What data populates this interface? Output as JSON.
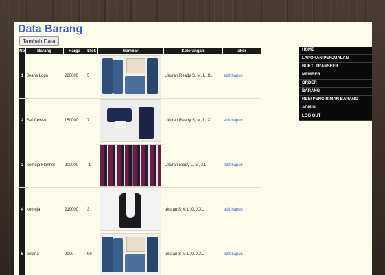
{
  "page": {
    "title": "Data Barang",
    "add_button": "Tambah Data"
  },
  "table": {
    "headers": [
      "No",
      "Barang",
      "Harga",
      "Stok",
      "Gambar",
      "Keterangan",
      "aksi"
    ],
    "rows": [
      {
        "no": "1",
        "name": "Jeans Logo",
        "price": "220000",
        "stock": "5",
        "note": "Ukuran Ready S, M, L, XL",
        "edit": "edit",
        "delete": "hapus"
      },
      {
        "no": "2",
        "name": "Set Cewek",
        "price": "150000",
        "stock": "7",
        "note": "Ukuran Ready S, M, L, XL",
        "edit": "edit",
        "delete": "hapus"
      },
      {
        "no": "3",
        "name": "kemeja Flannel",
        "price": "200000",
        "stock": "-1",
        "note": "Ukuran ready L, M, XL",
        "edit": "edit",
        "delete": "hapus"
      },
      {
        "no": "4",
        "name": "kemeja",
        "price": "210000",
        "stock": "3",
        "note": "ukuran S M L XL XXL",
        "edit": "edit",
        "delete": "hapus"
      },
      {
        "no": "5",
        "name": "celana",
        "price": "9000",
        "stock": "99",
        "note": "ukuran S M L XL XXL",
        "edit": "edit",
        "delete": "hapus"
      }
    ]
  },
  "nav": {
    "items": [
      "HOME",
      "LAPORAN PENJUALAN",
      "BUKTI TRANSFER",
      "MEMBER",
      "ORDER",
      "BARANG",
      "RESI PENGIRIMAN BARANG",
      "ADMIN",
      "LOG OUT"
    ]
  },
  "colors": {
    "title": "#3a5fc8",
    "link": "#3a66c4",
    "nav_bg": "#0a0a0a",
    "content_bg": "#fdfbea"
  }
}
